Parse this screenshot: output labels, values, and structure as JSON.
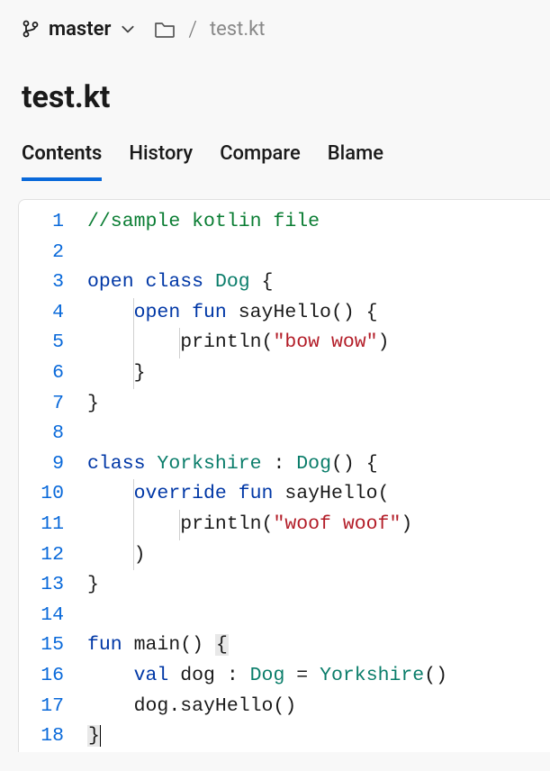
{
  "branch": "master",
  "breadcrumb": {
    "file": "test.kt"
  },
  "pageTitle": "test.kt",
  "tabs": [
    {
      "label": "Contents",
      "active": true
    },
    {
      "label": "History",
      "active": false
    },
    {
      "label": "Compare",
      "active": false
    },
    {
      "label": "Blame",
      "active": false
    }
  ],
  "code": {
    "lines": [
      {
        "n": 1,
        "tokens": [
          {
            "t": "//sample kotlin file",
            "c": "comment"
          }
        ]
      },
      {
        "n": 2,
        "tokens": []
      },
      {
        "n": 3,
        "tokens": [
          {
            "t": "open",
            "c": "keyword"
          },
          {
            "t": " "
          },
          {
            "t": "class",
            "c": "keyword"
          },
          {
            "t": " "
          },
          {
            "t": "Dog",
            "c": "type"
          },
          {
            "t": " {"
          }
        ]
      },
      {
        "n": 4,
        "tokens": [
          {
            "t": "    ",
            "guide": [
              4
            ]
          },
          {
            "t": "open",
            "c": "keyword"
          },
          {
            "t": " "
          },
          {
            "t": "fun",
            "c": "keyword"
          },
          {
            "t": " sayHello() {"
          }
        ]
      },
      {
        "n": 5,
        "tokens": [
          {
            "t": "        ",
            "guide": [
              4,
              8
            ]
          },
          {
            "t": "println("
          },
          {
            "t": "\"bow wow\"",
            "c": "string"
          },
          {
            "t": ")"
          }
        ]
      },
      {
        "n": 6,
        "tokens": [
          {
            "t": "    ",
            "guide": [
              4
            ]
          },
          {
            "t": "}"
          }
        ]
      },
      {
        "n": 7,
        "tokens": [
          {
            "t": "}"
          }
        ]
      },
      {
        "n": 8,
        "tokens": []
      },
      {
        "n": 9,
        "tokens": [
          {
            "t": "class",
            "c": "keyword"
          },
          {
            "t": " "
          },
          {
            "t": "Yorkshire",
            "c": "type"
          },
          {
            "t": " : "
          },
          {
            "t": "Dog",
            "c": "type"
          },
          {
            "t": "() {"
          }
        ]
      },
      {
        "n": 10,
        "tokens": [
          {
            "t": "    ",
            "guide": [
              4
            ]
          },
          {
            "t": "override",
            "c": "keyword"
          },
          {
            "t": " "
          },
          {
            "t": "fun",
            "c": "keyword"
          },
          {
            "t": " sayHello("
          }
        ]
      },
      {
        "n": 11,
        "tokens": [
          {
            "t": "        ",
            "guide": [
              4,
              8
            ]
          },
          {
            "t": "println("
          },
          {
            "t": "\"woof woof\"",
            "c": "string"
          },
          {
            "t": ")"
          }
        ]
      },
      {
        "n": 12,
        "tokens": [
          {
            "t": "    ",
            "guide": [
              4
            ]
          },
          {
            "t": ")"
          }
        ]
      },
      {
        "n": 13,
        "tokens": [
          {
            "t": "}"
          }
        ]
      },
      {
        "n": 14,
        "tokens": []
      },
      {
        "n": 15,
        "tokens": [
          {
            "t": "fun",
            "c": "keyword"
          },
          {
            "t": " main() "
          },
          {
            "t": "{",
            "box": true
          }
        ]
      },
      {
        "n": 16,
        "tokens": [
          {
            "t": "    "
          },
          {
            "t": "val",
            "c": "keyword"
          },
          {
            "t": " dog : "
          },
          {
            "t": "Dog",
            "c": "type"
          },
          {
            "t": " = "
          },
          {
            "t": "Yorkshire",
            "c": "type"
          },
          {
            "t": "()"
          }
        ]
      },
      {
        "n": 17,
        "tokens": [
          {
            "t": "    dog.sayHello()"
          }
        ]
      },
      {
        "n": 18,
        "tokens": [
          {
            "t": "}",
            "box": true
          },
          {
            "t": "",
            "caret": true
          }
        ]
      }
    ]
  }
}
